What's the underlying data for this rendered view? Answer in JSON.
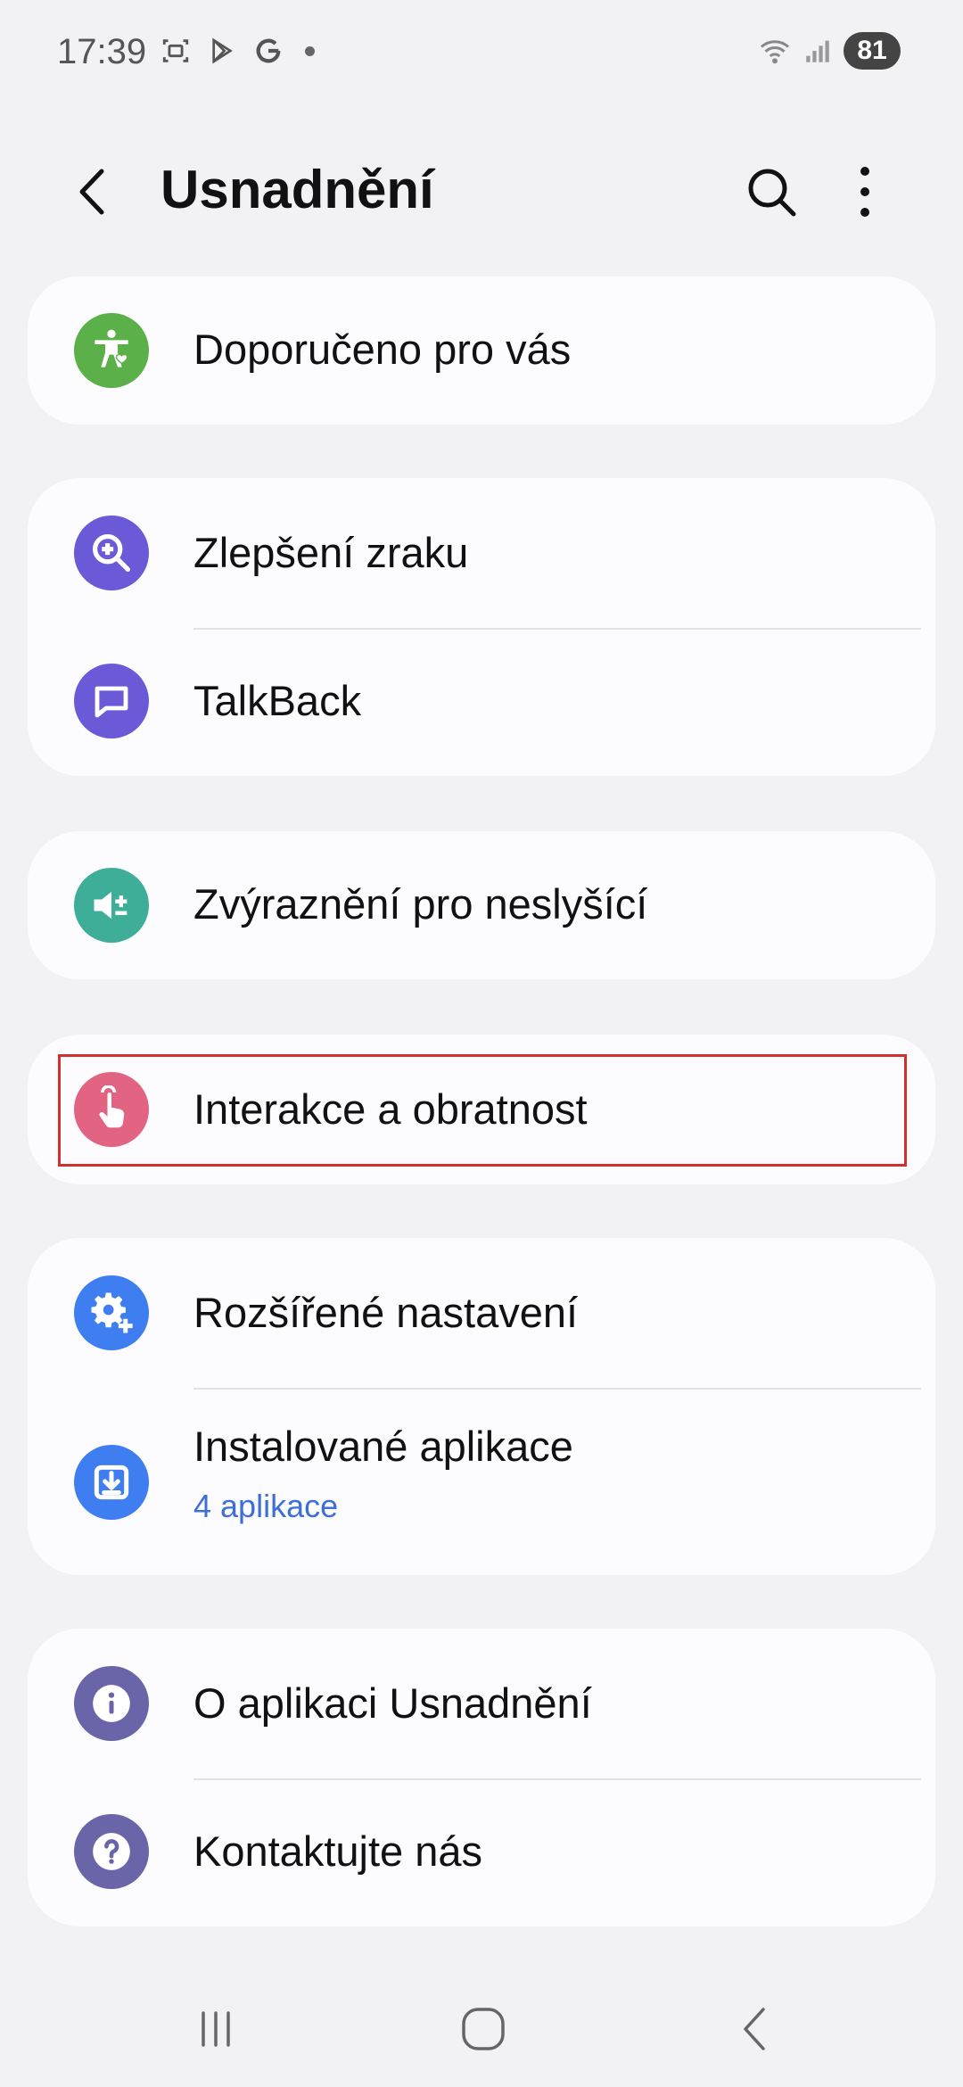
{
  "status_bar": {
    "time": "17:39",
    "battery": "81"
  },
  "header": {
    "title": "Usnadnění"
  },
  "colors": {
    "green": "#5bb04a",
    "purple": "#6a5ad8",
    "teal": "#3eae98",
    "pink": "#e26482",
    "blue": "#3e7ef0",
    "violet": "#6a64a8",
    "highlight": "#d32f2f",
    "link": "#3d6fd6"
  },
  "items": {
    "recommended": {
      "label": "Doporučeno pro vás",
      "icon": "accessibility-heart-icon"
    },
    "vision": {
      "label": "Zlepšení zraku",
      "icon": "zoom-in-icon"
    },
    "talkback": {
      "label": "TalkBack",
      "icon": "chat-bubble-icon"
    },
    "hearing": {
      "label": "Zvýraznění pro neslyšící",
      "icon": "speaker-plus-icon"
    },
    "interaction": {
      "label": "Interakce a obratnost",
      "icon": "touch-hand-icon"
    },
    "advanced": {
      "label": "Rozšířené nastavení",
      "icon": "gear-plus-icon"
    },
    "installed": {
      "label": "Instalované aplikace",
      "sub": "4 aplikace",
      "icon": "download-icon"
    },
    "about": {
      "label": "O aplikaci Usnadnění",
      "icon": "info-icon"
    },
    "contact": {
      "label": "Kontaktujte nás",
      "icon": "help-icon"
    }
  }
}
